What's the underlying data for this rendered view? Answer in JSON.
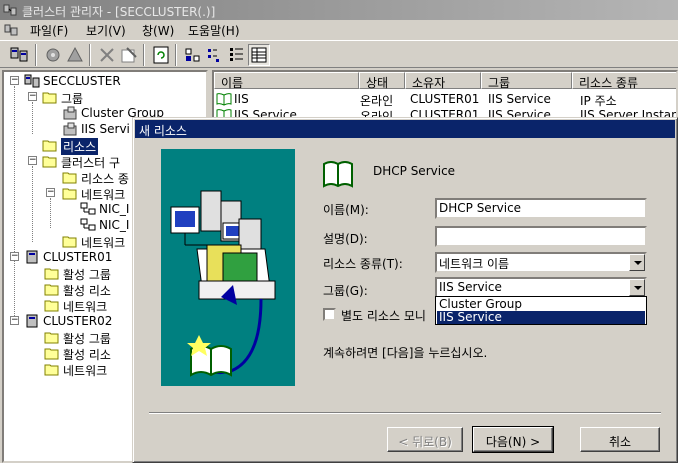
{
  "window": {
    "title": "클러스터 관리자 - [SECCLUSTER(.)]"
  },
  "menu": [
    "파일(F)",
    "보기(V)",
    "창(W)",
    "도움말(H)"
  ],
  "tree": {
    "root": "SECCLUSTER",
    "groups": "그룹",
    "cluster_group": "Cluster Group",
    "iis_service": "IIS Servi",
    "resources": "리소스",
    "cluster_config": "클러스터 구",
    "resource_types": "리소스 종",
    "networks": "네트워크",
    "nic1": "NIC_I",
    "nic2": "NIC_I",
    "network_if": "네트워크",
    "cluster01": "CLUSTER01",
    "c01_active_groups": "활성 그룹",
    "c01_active_res": "활성 리소",
    "c01_network": "네트워크",
    "cluster02": "CLUSTER02",
    "c02_active_groups": "활성 그룹",
    "c02_active_res": "활성 리소",
    "c02_network": "네트워크"
  },
  "list": {
    "columns": [
      "이름",
      "상태",
      "소유자",
      "그룹",
      "리소스 종류"
    ],
    "rows": [
      [
        "IIS",
        "온라인",
        "CLUSTER01",
        "IIS Service",
        "IP 주소"
      ],
      [
        "IIS Service",
        "온라인",
        "CLUSTER01",
        "IIS Service",
        "IIS Server Instance"
      ]
    ]
  },
  "dialog": {
    "title": "새 리소스",
    "heading": "DHCP Service",
    "name_label": "이름(M):",
    "name_value": "DHCP Service",
    "desc_label": "설명(D):",
    "desc_value": "",
    "type_label": "리소스 종류(T):",
    "type_value": "네트워크 이름",
    "group_label": "그룹(G):",
    "group_value": "IIS Service",
    "group_options": [
      "Cluster Group",
      "IIS Service"
    ],
    "group_selected": "IIS Service",
    "monitor_label": "별도 리소스 모니",
    "monitor_checked": false,
    "instruction": "계속하려면 [다음]을 누르십시오.",
    "back_button": "< 뒤로(B)",
    "next_button": "다음(N) >",
    "cancel_button": "취소"
  }
}
